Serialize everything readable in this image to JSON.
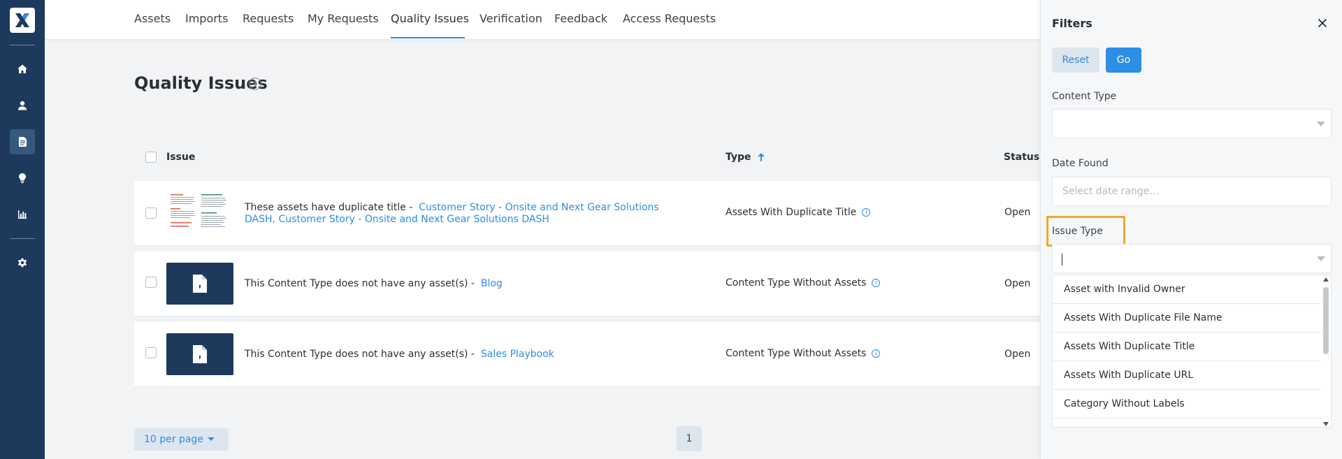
{
  "sidebar": {
    "logo": "x-logo",
    "items": [
      {
        "icon": "home-icon"
      },
      {
        "icon": "user-icon"
      },
      {
        "icon": "document-icon",
        "active": true
      },
      {
        "icon": "lightbulb-icon"
      },
      {
        "icon": "bar-chart-icon"
      },
      {
        "icon": "gear-icon"
      }
    ]
  },
  "topnav": {
    "tabs": [
      {
        "label": "Assets"
      },
      {
        "label": "Imports"
      },
      {
        "label": "Requests"
      },
      {
        "label": "My Requests"
      },
      {
        "label": "Quality Issues",
        "active": true
      },
      {
        "label": "Verification"
      },
      {
        "label": "Feedback"
      },
      {
        "label": "Access Requests"
      }
    ]
  },
  "page": {
    "title": "Quality Issues",
    "help_icon": "?"
  },
  "table": {
    "headers": {
      "issue": "Issue",
      "type": "Type",
      "status": "Status"
    },
    "rows": [
      {
        "issue_text": "These assets have duplicate title - ",
        "links": [
          "Customer Story - Onsite and Next Gear Solutions DASH,",
          "Customer Story - Onsite and Next Gear Solutions DASH"
        ],
        "type": "Assets With Duplicate Title",
        "status": "Open",
        "thumb": "document-preview"
      },
      {
        "issue_text": "This Content Type does not have any asset(s) - ",
        "links": [
          "Blog"
        ],
        "type": "Content Type Without Assets",
        "status": "Open",
        "thumb": "file-icon"
      },
      {
        "issue_text": "This Content Type does not have any asset(s) - ",
        "links": [
          "Sales Playbook"
        ],
        "type": "Content Type Without Assets",
        "status": "Open",
        "thumb": "file-icon"
      }
    ],
    "info_icon": "i"
  },
  "pagination": {
    "per_page": "10 per page",
    "current_page": "1"
  },
  "filters": {
    "title": "Filters",
    "reset_label": "Reset",
    "go_label": "Go",
    "content_type_label": "Content Type",
    "content_type_value": "",
    "date_found_label": "Date Found",
    "date_found_placeholder": "Select date range...",
    "issue_type_label": "Issue Type",
    "issue_type_value": "",
    "issue_type_options": [
      "Asset with Invalid Owner",
      "Assets With Duplicate File Name",
      "Assets With Duplicate Title",
      "Assets With Duplicate URL",
      "Category Without Labels"
    ]
  },
  "colors": {
    "sidebar": "#1d3a5c",
    "accent": "#2d8ee6",
    "highlight": "#f0a82a"
  }
}
